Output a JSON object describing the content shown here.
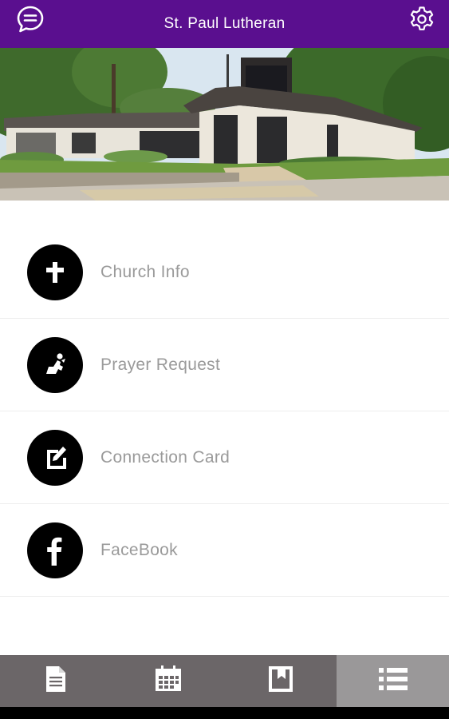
{
  "header": {
    "title": "St. Paul Lutheran",
    "left_icon": "chat-bubble-icon",
    "right_icon": "gear-icon",
    "background_color": "#5a0f8f"
  },
  "hero": {
    "image": "church-building-photo"
  },
  "menu": {
    "items": [
      {
        "label": "Church Info",
        "icon": "cross-icon"
      },
      {
        "label": "Prayer Request",
        "icon": "praying-figure-icon"
      },
      {
        "label": "Connection Card",
        "icon": "edit-note-icon"
      },
      {
        "label": "FaceBook",
        "icon": "facebook-icon"
      }
    ]
  },
  "tabbar": {
    "tabs": [
      {
        "icon": "document-icon",
        "active": false
      },
      {
        "icon": "calendar-icon",
        "active": false
      },
      {
        "icon": "bookmark-book-icon",
        "active": false
      },
      {
        "icon": "list-icon",
        "active": true
      }
    ],
    "background_color": "#6b6668",
    "active_color": "#9a9899"
  }
}
